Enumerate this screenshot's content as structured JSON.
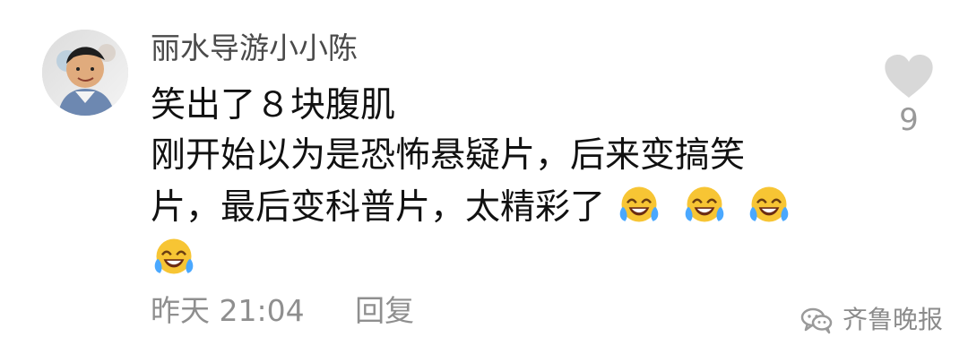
{
  "comment": {
    "username": "丽水导游小小陈",
    "lines": [
      "笑出了８块腹肌",
      "刚开始以为是恐怖悬疑片，后来变搞笑片，最后变科普片，太精彩了"
    ],
    "emojis": [
      "laughing-crying-emoji",
      "laughing-crying-emoji",
      "laughing-crying-emoji",
      "laughing-crying-emoji"
    ],
    "timestamp": "昨天 21:04",
    "reply_label": "回复",
    "like_count": "9"
  },
  "watermark": {
    "text": "齐鲁晚报"
  },
  "colors": {
    "username": "#4a4a4a",
    "body": "#111111",
    "meta": "#8f8f8f",
    "heart": "#d8d8d8",
    "emoji_face": "#f7c534",
    "emoji_tears": "#4aa8ff"
  }
}
